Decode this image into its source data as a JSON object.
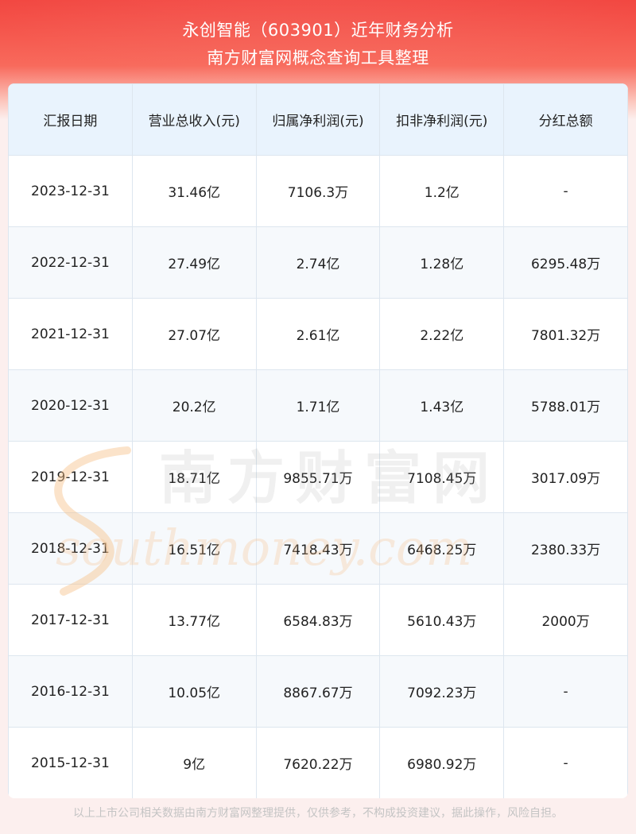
{
  "header": {
    "title": "永创智能（603901）近年财务分析",
    "subtitle": "南方财富网概念查询工具整理"
  },
  "table": {
    "columns": [
      "汇报日期",
      "营业总收入(元)",
      "归属净利润(元)",
      "扣非净利润(元)",
      "分红总额"
    ],
    "rows": [
      [
        "2023-12-31",
        "31.46亿",
        "7106.3万",
        "1.2亿",
        "-"
      ],
      [
        "2022-12-31",
        "27.49亿",
        "2.74亿",
        "1.28亿",
        "6295.48万"
      ],
      [
        "2021-12-31",
        "27.07亿",
        "2.61亿",
        "2.22亿",
        "7801.32万"
      ],
      [
        "2020-12-31",
        "20.2亿",
        "1.71亿",
        "1.43亿",
        "5788.01万"
      ],
      [
        "2019-12-31",
        "18.71亿",
        "9855.71万",
        "7108.45万",
        "3017.09万"
      ],
      [
        "2018-12-31",
        "16.51亿",
        "7418.43万",
        "6468.25万",
        "2380.33万"
      ],
      [
        "2017-12-31",
        "13.77亿",
        "6584.83万",
        "5610.43万",
        "2000万"
      ],
      [
        "2016-12-31",
        "10.05亿",
        "8867.67万",
        "7092.23万",
        "-"
      ],
      [
        "2015-12-31",
        "9亿",
        "7620.22万",
        "6980.92万",
        "-"
      ]
    ]
  },
  "watermark": {
    "cn_text": "南方财富网",
    "en_text": "southmoney.com"
  },
  "footer": {
    "text": "以上上市公司相关数据由南方财富网整理提供，仅供参考，不构成投资建议，据此操作，风险自担。"
  },
  "colors": {
    "header_red": "#f2453f",
    "table_header_bg": "#e9f3fd",
    "watermark_orange": "#f6c08a"
  }
}
